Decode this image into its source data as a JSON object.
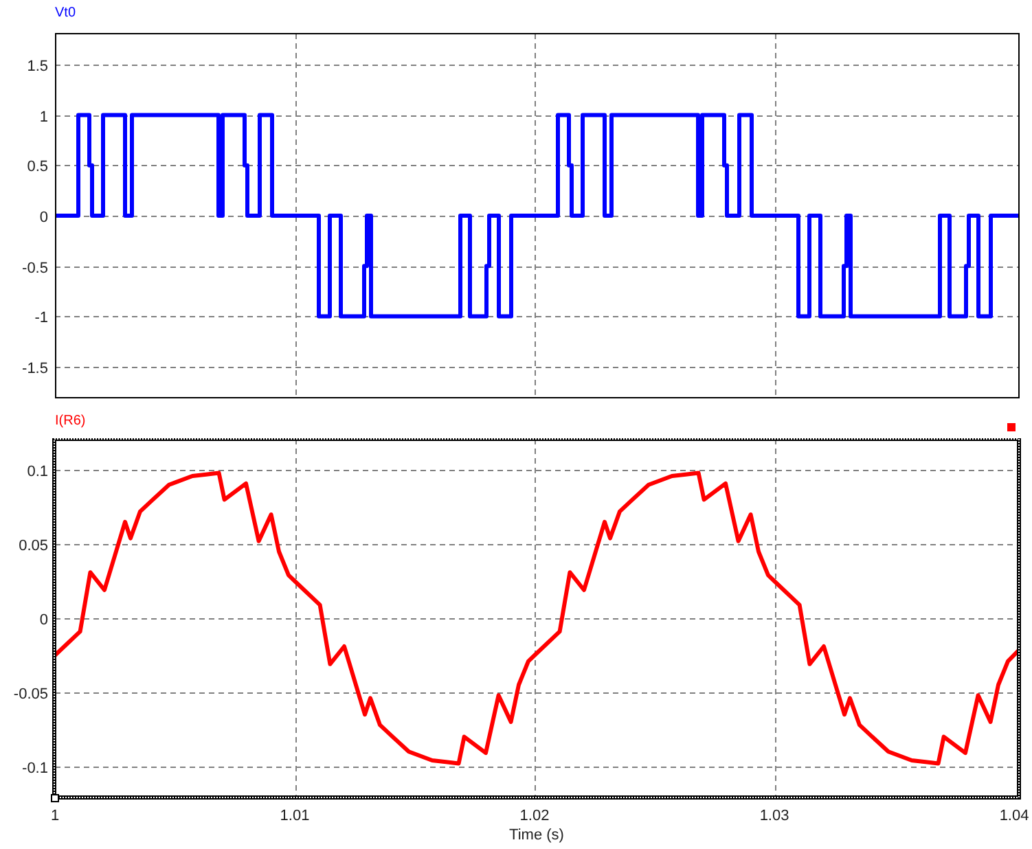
{
  "plots": [
    {
      "chart_data": {
        "type": "line",
        "xlim": [
          1,
          1.04017
        ],
        "ylim": [
          -1.81,
          1.81
        ],
        "yticks": [
          -1.5,
          -1,
          -0.5,
          0,
          0.5,
          1,
          1.5
        ],
        "grid": true,
        "x": [
          1,
          1.000974,
          1.000974,
          1.001433,
          1.001433,
          1.001547,
          1.001547,
          1.002006,
          1.002006,
          1.002923,
          1.002923,
          1.003209,
          1.003209,
          1.006819,
          1.006819,
          1.006991,
          1.006991,
          1.007908,
          1.007908,
          1.008023,
          1.008023,
          1.008539,
          1.008539,
          1.009054,
          1.009054,
          1.011003,
          1.011003,
          1.011461,
          1.011461,
          1.01192,
          1.01192,
          1.012894,
          1.012894,
          1.013009,
          1.013009,
          1.013181,
          1.013181,
          1.016905,
          1.016905,
          1.017307,
          1.017307,
          1.017994,
          1.017994,
          1.018109,
          1.018109,
          1.01851,
          1.01851,
          1.019026,
          1.019026,
          1.02,
          1.020974,
          1.020974,
          1.021433,
          1.021433,
          1.021547,
          1.021547,
          1.022006,
          1.022006,
          1.022923,
          1.022923,
          1.023209,
          1.023209,
          1.026819,
          1.026819,
          1.026991,
          1.026991,
          1.027908,
          1.027908,
          1.028023,
          1.028023,
          1.028539,
          1.028539,
          1.029054,
          1.029054,
          1.031003,
          1.031003,
          1.031461,
          1.031461,
          1.03192,
          1.03192,
          1.032894,
          1.032894,
          1.033009,
          1.033009,
          1.033181,
          1.033181,
          1.036905,
          1.036905,
          1.037307,
          1.037307,
          1.037994,
          1.037994,
          1.038109,
          1.038109,
          1.03851,
          1.03851,
          1.039026,
          1.039026,
          1.04017
        ],
        "series": [
          {
            "name": "Vt0",
            "color": "#0000ff",
            "values": [
              0,
              0,
              1,
              1,
              0.5,
              0.5,
              0,
              0,
              1,
              1,
              0,
              0,
              1,
              1,
              0,
              0,
              1,
              1,
              0.5,
              0.5,
              0,
              0,
              1,
              1,
              0,
              0,
              -1,
              -1,
              0,
              0,
              -1,
              -1,
              -0.5,
              -0.5,
              0,
              0,
              -1,
              -1,
              0,
              0,
              -1,
              -1,
              -0.5,
              -0.5,
              0,
              0,
              -1,
              -1,
              0,
              0,
              0,
              1,
              1,
              0.5,
              0.5,
              0,
              0,
              1,
              1,
              0,
              0,
              1,
              1,
              0,
              0,
              1,
              1,
              0.5,
              0.5,
              0,
              0,
              1,
              1,
              0,
              0,
              -1,
              -1,
              0,
              0,
              -1,
              -1,
              -0.5,
              -0.5,
              0,
              0,
              -1,
              -1,
              0,
              0,
              -1,
              -1,
              -0.5,
              -0.5,
              0,
              0,
              -1,
              -1,
              0,
              0
            ]
          }
        ]
      },
      "selected": false
    },
    {
      "chart_data": {
        "type": "line",
        "xlabel": "Time (s)",
        "xlim": [
          1,
          1.04017
        ],
        "ylim": [
          -0.121,
          0.121
        ],
        "yticks": [
          -0.1,
          -0.05,
          0,
          0.05,
          0.1
        ],
        "xticks": [
          1,
          1.01,
          1.02,
          1.03,
          1.04
        ],
        "grid": true,
        "x": [
          1,
          1.001049,
          1.001473,
          1.002063,
          1.002923,
          1.003152,
          1.003553,
          1.004011,
          1.004756,
          1.005731,
          1.006304,
          1.006837,
          1.007066,
          1.007966,
          1.008499,
          1.009014,
          1.009341,
          1.009742,
          1.01,
          1.011049,
          1.011473,
          1.012063,
          1.012923,
          1.013152,
          1.013553,
          1.014011,
          1.014756,
          1.015731,
          1.016304,
          1.016837,
          1.017066,
          1.017966,
          1.018499,
          1.019014,
          1.019341,
          1.019742,
          1.02,
          1.021049,
          1.021473,
          1.022063,
          1.022923,
          1.023152,
          1.023553,
          1.024011,
          1.024756,
          1.025731,
          1.026304,
          1.026837,
          1.027066,
          1.027966,
          1.028499,
          1.029014,
          1.029341,
          1.029742,
          1.03,
          1.031049,
          1.031473,
          1.032063,
          1.032923,
          1.033152,
          1.033553,
          1.034011,
          1.034756,
          1.035731,
          1.036304,
          1.036837,
          1.037066,
          1.037966,
          1.038499,
          1.039014,
          1.039341,
          1.039742,
          1.04017
        ],
        "series": [
          {
            "name": "I(R6)",
            "color": "#ff0000",
            "values": [
              -0.025,
              -0.009,
              0.031,
              0.019,
              0.065,
              0.054,
              0.072,
              0.079,
              0.09,
              0.096,
              0.097,
              0.098,
              0.08,
              0.091,
              0.052,
              0.07,
              0.045,
              0.029,
              0.025,
              0.009,
              -0.031,
              -0.019,
              -0.065,
              -0.054,
              -0.072,
              -0.079,
              -0.09,
              -0.096,
              -0.097,
              -0.098,
              -0.08,
              -0.091,
              -0.052,
              -0.07,
              -0.045,
              -0.029,
              -0.025,
              -0.009,
              0.031,
              0.019,
              0.065,
              0.054,
              0.072,
              0.079,
              0.09,
              0.096,
              0.097,
              0.098,
              0.08,
              0.091,
              0.052,
              0.07,
              0.045,
              0.029,
              0.025,
              0.009,
              -0.031,
              -0.019,
              -0.065,
              -0.054,
              -0.072,
              -0.079,
              -0.09,
              -0.096,
              -0.097,
              -0.098,
              -0.08,
              -0.091,
              -0.052,
              -0.07,
              -0.045,
              -0.029,
              -0.022
            ]
          }
        ]
      },
      "selected": true
    }
  ]
}
